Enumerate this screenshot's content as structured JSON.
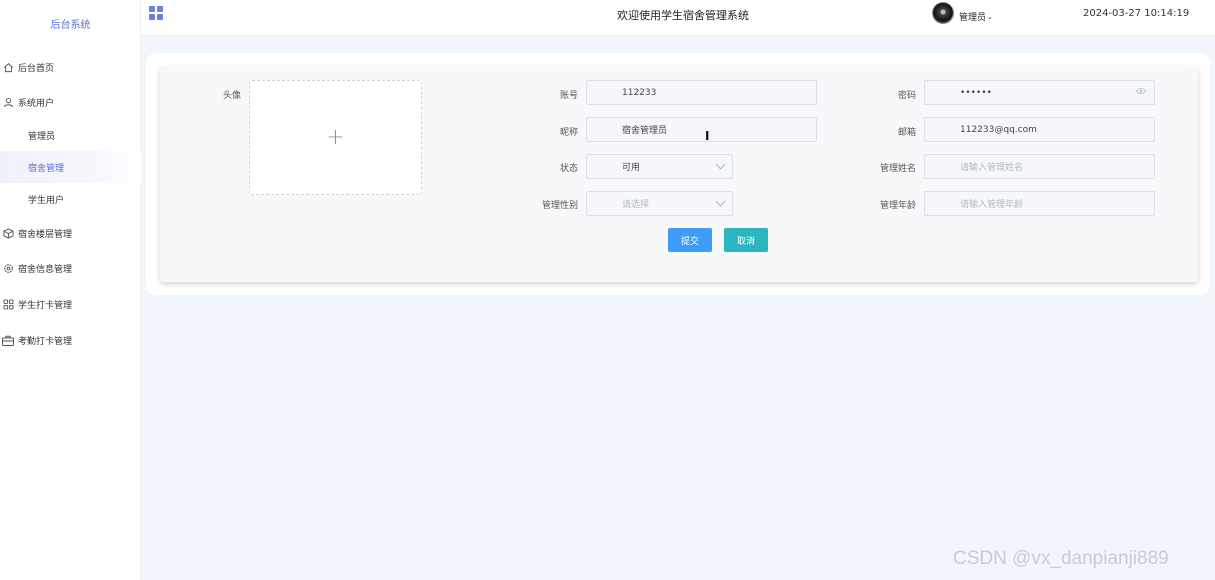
{
  "sidebar": {
    "brand": "后台系统",
    "items": [
      {
        "label": "后台首页",
        "icon": "home-icon"
      },
      {
        "label": "系统用户",
        "icon": "user-icon"
      },
      {
        "label": "管理员"
      },
      {
        "label": "宿舍管理",
        "active": true
      },
      {
        "label": "学生用户"
      },
      {
        "label": "宿舍楼层管理",
        "icon": "cube-icon"
      },
      {
        "label": "宿舍信息管理",
        "icon": "gear-icon"
      },
      {
        "label": "学生打卡管理",
        "icon": "apps-icon"
      },
      {
        "label": "考勤打卡管理",
        "icon": "briefcase-icon"
      }
    ]
  },
  "header": {
    "title": "欢迎使用学生宿舍管理系统",
    "user": "管理员",
    "datetime": "2024-03-27 10:14:19"
  },
  "form": {
    "avatar_label": "头像",
    "avatar_plus": "+",
    "account_label": "账号",
    "account_value": "112233",
    "password_label": "密码",
    "password_value": "••••••",
    "nickname_label": "昵称",
    "nickname_value": "宿舍管理员",
    "email_label": "邮箱",
    "email_value": "112233@qq.com",
    "status_label": "状态",
    "status_value": "可用",
    "manager_name_label": "管理姓名",
    "manager_name_placeholder": "请输入管理姓名",
    "manager_gender_label": "管理性别",
    "manager_gender_placeholder": "请选择",
    "manager_age_label": "管理年龄",
    "manager_age_placeholder": "请输入管理年龄",
    "submit_label": "提交",
    "cancel_label": "取消"
  },
  "watermark": "CSDN @vx_danpianji889",
  "colors": {
    "accent": "#5a6fd6",
    "submit": "#3e9cf7",
    "cancel": "#2bb6bf",
    "background": "#f1f5fc"
  }
}
